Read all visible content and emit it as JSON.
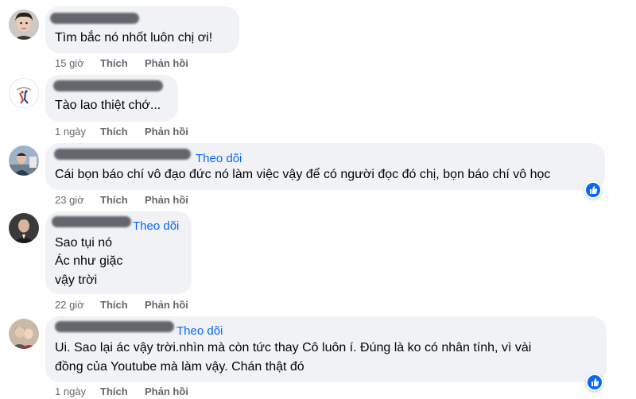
{
  "colors": {
    "bubble": "#f0f2f5",
    "follow": "#0866ff",
    "meta": "#65676b",
    "text": "#050505"
  },
  "comments": [
    {
      "lines": [
        "Tìm bắc nó nhốt luôn chị ơi!"
      ],
      "time": "15 giờ",
      "like": "Thích",
      "reply": "Phản hồi"
    },
    {
      "lines": [
        "Tào lao thiệt chớ..."
      ],
      "time": "1 ngày",
      "like": "Thích",
      "reply": "Phản hồi"
    },
    {
      "follow": "Theo dõi",
      "lines": [
        "Cái bọn báo chí vô đạo đức nó làm việc vậy để có người đọc đó chị, bọn báo chí vô học"
      ],
      "time": "23 giờ",
      "like": "Thích",
      "reply": "Phản hồi",
      "reaction_icon": "like-icon"
    },
    {
      "follow": "Theo dõi",
      "lines": [
        "Sao tụi nó",
        "Ác như giặc",
        "vậy trời"
      ],
      "time": "22 giờ",
      "like": "Thích",
      "reply": "Phản hồi"
    },
    {
      "follow": "Theo dõi",
      "lines": [
        "Ui. Sao lại ác vậy trời.nhìn mà còn tức thay Cô luôn í. Đúng là ko có nhân tính, vì vài",
        "đồng của Youtube mà làm vậy. Chán thật đó"
      ],
      "time": "1 ngày",
      "like": "Thích",
      "reply": "Phản hồi",
      "reaction_icon": "like-icon"
    }
  ]
}
